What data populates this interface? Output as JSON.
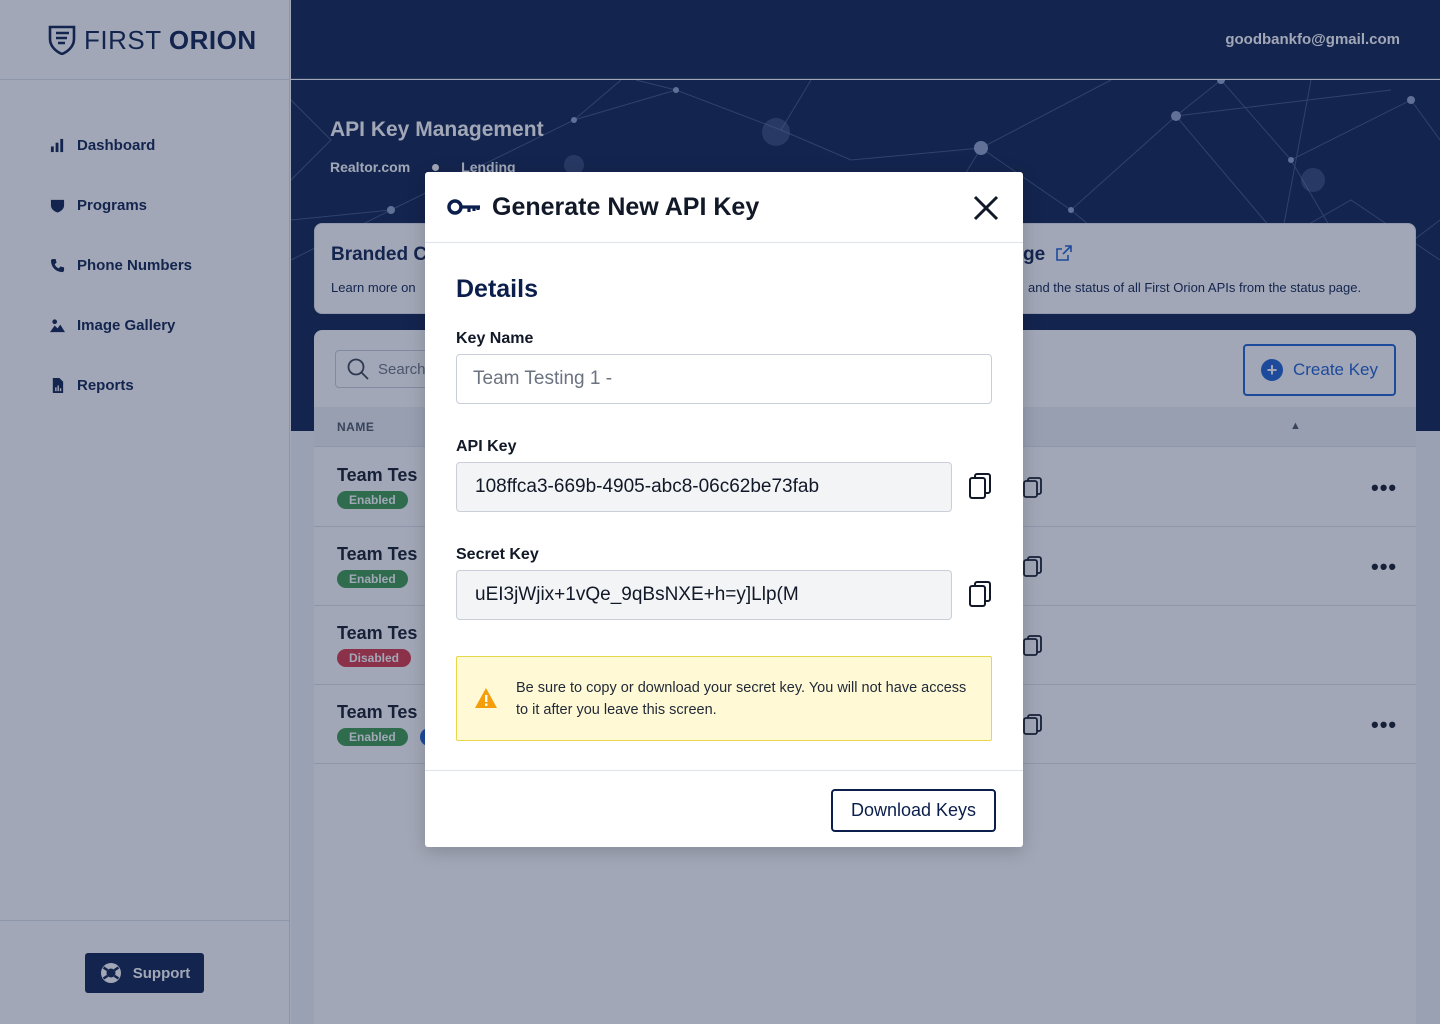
{
  "brand": {
    "word_light": "FIRST",
    "word_bold": "ORION"
  },
  "header": {
    "user_email": "goodbankfo@gmail.com"
  },
  "sidebar": {
    "items": [
      {
        "label": "Dashboard",
        "icon": "bar-chart-icon"
      },
      {
        "label": "Programs",
        "icon": "shield-icon"
      },
      {
        "label": "Phone Numbers",
        "icon": "phone-icon"
      },
      {
        "label": "Image Gallery",
        "icon": "image-icon"
      },
      {
        "label": "Reports",
        "icon": "report-icon"
      }
    ],
    "support_label": "Support"
  },
  "page": {
    "title": "API Key Management",
    "breadcrumbs": [
      "Realtor.com",
      "Lending"
    ]
  },
  "cards": {
    "left": {
      "title": "Branded C",
      "text": "Learn more on"
    },
    "right": {
      "title": "ge",
      "text": "and the status of all First Orion APIs from the status page."
    }
  },
  "table": {
    "search_placeholder": "Search",
    "create_label": "Create Key",
    "column_name": "NAME",
    "rows": [
      {
        "name": "Team Tes",
        "status": "Enabled"
      },
      {
        "name": "Team Tes",
        "status": "Enabled"
      },
      {
        "name": "Team Tes",
        "status": "Disabled"
      },
      {
        "name": "Team Tes",
        "status": "Enabled"
      }
    ]
  },
  "modal": {
    "title": "Generate New API Key",
    "section": "Details",
    "key_name_label": "Key Name",
    "key_name_value": "Team Testing 1 -",
    "api_key_label": "API Key",
    "api_key_value": "108ffca3-669b-4905-abc8-06c62be73fab",
    "secret_key_label": "Secret Key",
    "secret_key_value": "uEI3jWjix+1vQe_9qBsNXE+h=y]Llp(M",
    "warning": "Be sure to copy or download your secret key. You will not have access to it after you leave this screen.",
    "download_label": "Download Keys"
  },
  "colors": {
    "navy": "#0b1e4c",
    "accent": "#1d5fd1",
    "enabled": "#3a9a4a",
    "disabled": "#d93545",
    "warning_bg": "#fff9d6"
  }
}
